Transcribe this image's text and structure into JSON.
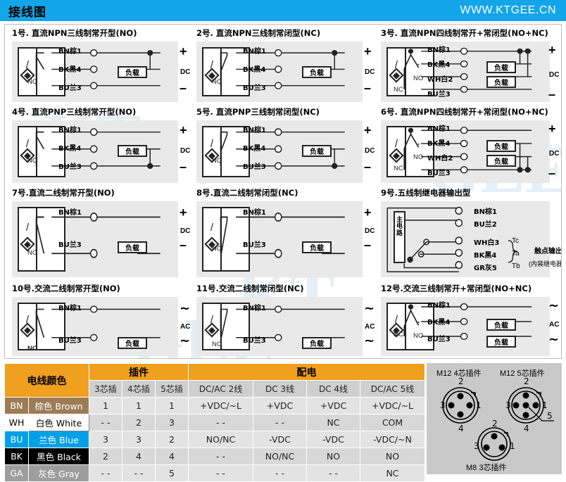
{
  "header": {
    "title": "接线图",
    "url": "WWW.KTGEE.CN"
  },
  "watermark": "KTGEE",
  "labels": {
    "bn": "BN棕1",
    "bk": "BK黑4",
    "bu": "BU兰3",
    "wh": "WH白2",
    "bn2": "BN棕1",
    "bu2": "BU兰2",
    "wh3": "WH白3",
    "bk4": "BK黑4",
    "gr5": "GR灰5",
    "load": "负载",
    "dc": "DC",
    "ac": "AC",
    "no": "NO",
    "nc": "NC",
    "plus": "+",
    "minus": "–",
    "tilde": "∼",
    "main_circuit": "主电路",
    "tc": "Tc",
    "ta": "Ta",
    "tb": "Tb",
    "contact_out": "触点输出",
    "builtin_relay": "(内装继电器)"
  },
  "diagrams": [
    {
      "id": 1,
      "title": "1号. 直流NPN三线制常开型(NO)",
      "sw": "NO"
    },
    {
      "id": 2,
      "title": "2号. 直流NPN三线制常闭型(NC)",
      "sw": "NC"
    },
    {
      "id": 3,
      "title": "3号. 直流NPN四线制常开+常闭型(NO+NC)",
      "sw": "NO+NC"
    },
    {
      "id": 4,
      "title": "4号. 直流PNP三线制常开型(NO)",
      "sw": "NO"
    },
    {
      "id": 5,
      "title": "5号. 直流PNP三线制常闭型(NC)",
      "sw": "NC"
    },
    {
      "id": 6,
      "title": "6号. 直流NPN四线制常开+常闭型(NO+NC)",
      "sw": "NO+NC"
    },
    {
      "id": 7,
      "title": "7号.直流二线制常开型(NO)",
      "sw": "NO"
    },
    {
      "id": 8,
      "title": "8号.直流二线制常闭型(NC)",
      "sw": "NC"
    },
    {
      "id": 9,
      "title": "9号.五线制继电器输出型",
      "sw": ""
    },
    {
      "id": 10,
      "title": "10号.交流二线制常开型(NO)",
      "sw": "NO"
    },
    {
      "id": 11,
      "title": "11号.交流二线制常闭型(NC)",
      "sw": "NC"
    },
    {
      "id": 12,
      "title": "12号.交流三线制常开+常闭型(NO+NC)",
      "sw": "NO+NC"
    }
  ],
  "spec_table": {
    "group_headers": {
      "color": "电线颜色",
      "plug": "插件",
      "power": "配电"
    },
    "sub_headers": [
      "3芯插",
      "4芯插",
      "5芯插",
      "DC/AC 2线",
      "DC 3线",
      "DC 4线",
      "DC/AC 5线"
    ],
    "rows": [
      {
        "code": "BN",
        "name": "棕色 Brown",
        "bg": "#9C7B55",
        "fg": "#ffffff",
        "values": [
          "1",
          "1",
          "1",
          "+VDC/~L",
          "+VDC",
          "+VDC",
          "+VDC/~L"
        ]
      },
      {
        "code": "WH",
        "name": "白色 White",
        "bg": "#ffffff",
        "fg": "#000000",
        "values": [
          "- -",
          "2",
          "3",
          "- -",
          "- -",
          "NC",
          "COM"
        ]
      },
      {
        "code": "BU",
        "name": "兰色 Blue",
        "bg": "#00A0E9",
        "fg": "#ffffff",
        "values": [
          "3",
          "3",
          "2",
          "NO/NC",
          "-VDC",
          "-VDC",
          "-VDC/~N"
        ]
      },
      {
        "code": "BK",
        "name": "黑色 Black",
        "bg": "#000000",
        "fg": "#ffffff",
        "values": [
          "2",
          "4",
          "4",
          "- -",
          "NO/NC",
          "NO",
          "NO"
        ]
      },
      {
        "code": "GA",
        "name": "灰色 Gray",
        "bg": "#9E9E9E",
        "fg": "#ffffff",
        "values": [
          "- -",
          "- -",
          "5",
          "- -",
          "- -",
          "- -",
          "NC"
        ]
      }
    ]
  },
  "connectors": [
    {
      "name": "M12 4芯插件",
      "pins": [
        "1",
        "2",
        "3",
        "4"
      ]
    },
    {
      "name": "M12 5芯插件",
      "pins": [
        "1",
        "2",
        "3",
        "4",
        "5"
      ]
    },
    {
      "name": "M8 3芯插件",
      "pins": [
        "1",
        "2",
        "3"
      ]
    }
  ],
  "colors": {
    "header_bg": "#12A5E8",
    "table_header": "#F0A01E",
    "cell_bg": "#e3e3e3"
  }
}
